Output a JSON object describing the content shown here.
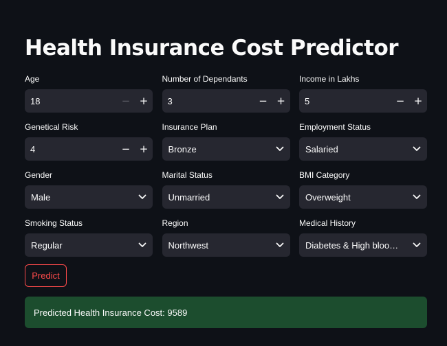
{
  "page": {
    "title": "Health Insurance Cost Predictor"
  },
  "fields": {
    "age": {
      "label": "Age",
      "value": "18",
      "minus": "−",
      "plus": "+"
    },
    "dependants": {
      "label": "Number of Dependants",
      "value": "3",
      "minus": "−",
      "plus": "+"
    },
    "income": {
      "label": "Income in Lakhs",
      "value": "5",
      "minus": "−",
      "plus": "+"
    },
    "genetical_risk": {
      "label": "Genetical Risk",
      "value": "4",
      "minus": "−",
      "plus": "+"
    },
    "insurance_plan": {
      "label": "Insurance Plan",
      "value": "Bronze"
    },
    "employment_status": {
      "label": "Employment Status",
      "value": "Salaried"
    },
    "gender": {
      "label": "Gender",
      "value": "Male"
    },
    "marital_status": {
      "label": "Marital Status",
      "value": "Unmarried"
    },
    "bmi_category": {
      "label": "BMI Category",
      "value": "Overweight"
    },
    "smoking_status": {
      "label": "Smoking Status",
      "value": "Regular"
    },
    "region": {
      "label": "Region",
      "value": "Northwest"
    },
    "medical_history": {
      "label": "Medical History",
      "value": "Diabetes & High blood pressure"
    }
  },
  "actions": {
    "predict_label": "Predict"
  },
  "result": {
    "text": "Predicted Health Insurance Cost: 9589"
  },
  "colors": {
    "background": "#0e1117",
    "input_bg": "#262730",
    "accent": "#ff4b4b",
    "success_bg": "#1c4d2e",
    "text": "#fafafa"
  },
  "icons": {
    "stepper_decrement": "minus-icon",
    "stepper_increment": "plus-icon",
    "select_open": "chevron-down-icon"
  }
}
